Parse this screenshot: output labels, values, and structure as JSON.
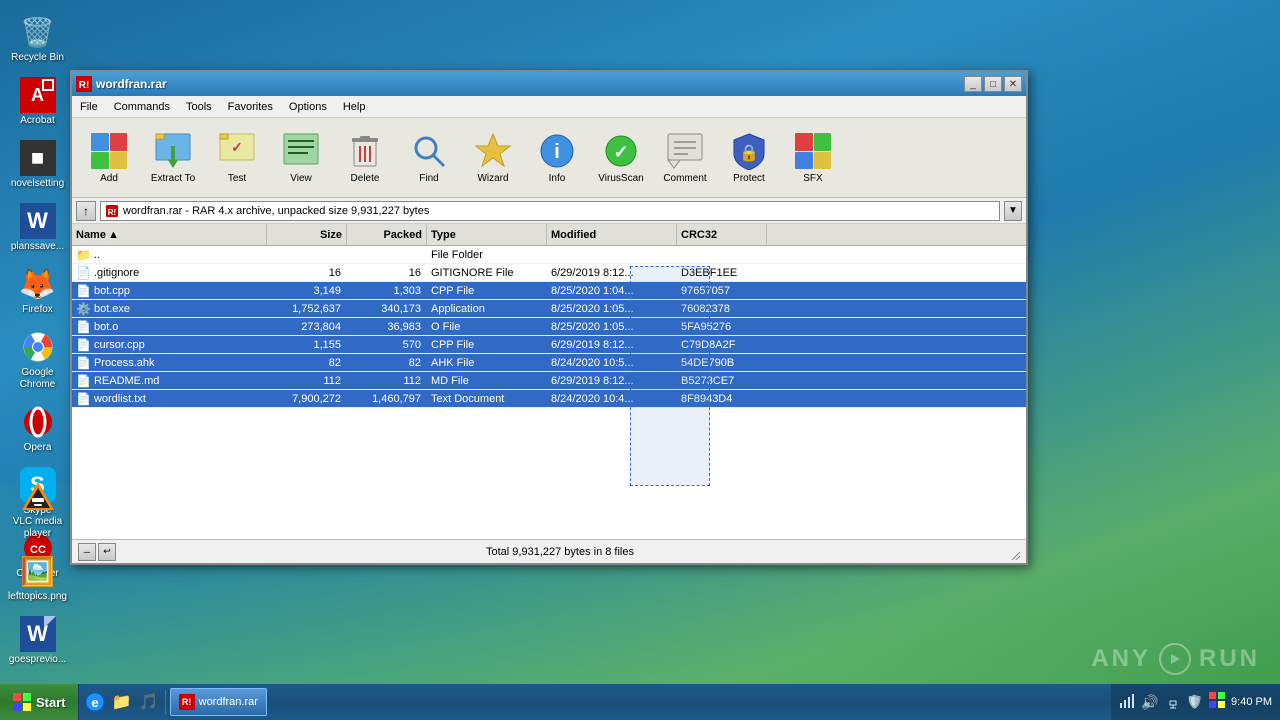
{
  "desktop": {
    "background": "#1a6b9a"
  },
  "desktop_icons_left": [
    {
      "id": "recycle-bin",
      "label": "Recycle Bin",
      "icon": "🗑️"
    },
    {
      "id": "acrobat",
      "label": "Acrobat",
      "icon": "PDF"
    },
    {
      "id": "notepad-settings",
      "label": "novelsetting",
      "icon": "■"
    },
    {
      "id": "word",
      "label": "planssave...",
      "icon": "W"
    },
    {
      "id": "firefox",
      "label": "Firefox",
      "icon": "🦊"
    },
    {
      "id": "google-chrome",
      "label": "Google Chrome",
      "icon": "⬤"
    },
    {
      "id": "opera",
      "label": "Opera",
      "icon": "O"
    },
    {
      "id": "skype",
      "label": "Skype",
      "icon": "S"
    },
    {
      "id": "ccleaner",
      "label": "CCleaner",
      "icon": "CC"
    }
  ],
  "bottom_desktop_icons": [
    {
      "id": "vlc",
      "label": "VLC media player",
      "icon": "🔶"
    },
    {
      "id": "lefttopics",
      "label": "lefttopics.png",
      "icon": "🖼️"
    },
    {
      "id": "goesprevio",
      "label": "goesprevio...",
      "icon": "📄"
    }
  ],
  "winrar": {
    "title": "wordfran.rar",
    "title_full": "wordfran.rar",
    "menu_items": [
      "File",
      "Commands",
      "Tools",
      "Favorites",
      "Options",
      "Help"
    ],
    "toolbar_buttons": [
      {
        "id": "add",
        "label": "Add",
        "icon": "add"
      },
      {
        "id": "extract-to",
        "label": "Extract To",
        "icon": "extract"
      },
      {
        "id": "test",
        "label": "Test",
        "icon": "test"
      },
      {
        "id": "view",
        "label": "View",
        "icon": "view"
      },
      {
        "id": "delete",
        "label": "Delete",
        "icon": "delete"
      },
      {
        "id": "find",
        "label": "Find",
        "icon": "find"
      },
      {
        "id": "wizard",
        "label": "Wizard",
        "icon": "wizard"
      },
      {
        "id": "info",
        "label": "Info",
        "icon": "info"
      },
      {
        "id": "virusscan",
        "label": "VirusScan",
        "icon": "virusscan"
      },
      {
        "id": "comment",
        "label": "Comment",
        "icon": "comment"
      },
      {
        "id": "protect",
        "label": "Protect",
        "icon": "protect"
      },
      {
        "id": "sfx",
        "label": "SFX",
        "icon": "sfx"
      }
    ],
    "address_bar": {
      "back_label": "↑",
      "path": " wordfran.rar - RAR 4.x archive, unpacked size 9,931,227 bytes"
    },
    "columns": [
      {
        "id": "name",
        "label": "Name",
        "sort": "asc"
      },
      {
        "id": "size",
        "label": "Size"
      },
      {
        "id": "packed",
        "label": "Packed"
      },
      {
        "id": "type",
        "label": "Type"
      },
      {
        "id": "modified",
        "label": "Modified"
      },
      {
        "id": "crc32",
        "label": "CRC32"
      }
    ],
    "files": [
      {
        "name": "..",
        "size": "",
        "packed": "",
        "type": "File Folder",
        "modified": "",
        "crc32": "",
        "selected": false,
        "icon": "📁"
      },
      {
        "name": ".gitignore",
        "size": "16",
        "packed": "16",
        "type": "GITIGNORE File",
        "modified": "6/29/2019 8:12...",
        "crc32": "D3EBF1EE",
        "selected": false,
        "icon": "📄"
      },
      {
        "name": "bot.cpp",
        "size": "3,149",
        "packed": "1,303",
        "type": "CPP File",
        "modified": "8/25/2020 1:04...",
        "crc32": "97657057",
        "selected": true,
        "icon": "📄"
      },
      {
        "name": "bot.exe",
        "size": "1,752,637",
        "packed": "340,173",
        "type": "Application",
        "modified": "8/25/2020 1:05...",
        "crc32": "76082378",
        "selected": true,
        "icon": "⚙️"
      },
      {
        "name": "bot.o",
        "size": "273,804",
        "packed": "36,983",
        "type": "O File",
        "modified": "8/25/2020 1:05...",
        "crc32": "5FA95276",
        "selected": true,
        "icon": "📄"
      },
      {
        "name": "cursor.cpp",
        "size": "1,155",
        "packed": "570",
        "type": "CPP File",
        "modified": "6/29/2019 8:12...",
        "crc32": "C79D8A2F",
        "selected": true,
        "icon": "📄"
      },
      {
        "name": "Process.ahk",
        "size": "82",
        "packed": "82",
        "type": "AHK File",
        "modified": "8/24/2020 10:5...",
        "crc32": "54DE790B",
        "selected": true,
        "icon": "📄"
      },
      {
        "name": "README.md",
        "size": "112",
        "packed": "112",
        "type": "MD File",
        "modified": "6/29/2019 8:12...",
        "crc32": "B5273CE7",
        "selected": true,
        "icon": "📄"
      },
      {
        "name": "wordlist.txt",
        "size": "7,900,272",
        "packed": "1,460,797",
        "type": "Text Document",
        "modified": "8/24/2020 10:4...",
        "crc32": "8F8943D4",
        "selected": true,
        "icon": "📄"
      }
    ],
    "status": {
      "total": "Total 9,931,227 bytes in 8 files"
    }
  },
  "taskbar": {
    "start_label": "Start",
    "items": [
      {
        "label": "wordfran.rar",
        "active": true
      }
    ],
    "tray_time": "9:40 PM"
  },
  "anyrun": {
    "text": "ANY▶RUN"
  }
}
